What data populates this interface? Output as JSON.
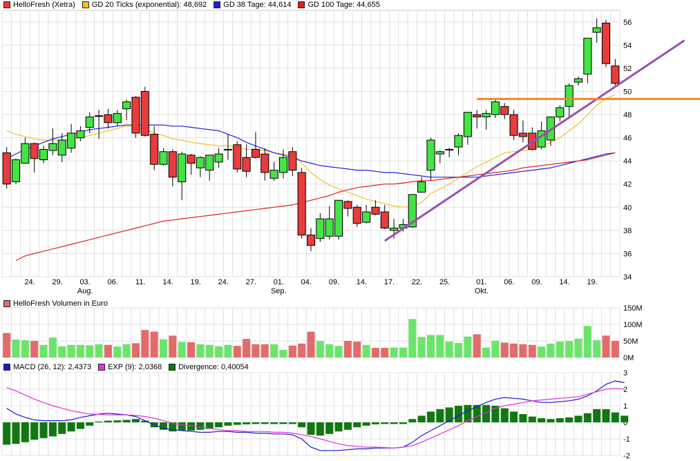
{
  "colors": {
    "up_candle": "#44e444",
    "down_candle": "#e83c3c",
    "volume_bar": "#e36b6b",
    "volume_bar_up": "#6ce46c",
    "gd20": "#f0c020",
    "gd38": "#2020dd",
    "gd100": "#dd2020",
    "trendline": "#9a4fb0",
    "resistance": "#f0882a",
    "macd": "#1a1ad0",
    "exp": "#e030e0",
    "divergence": "#117711",
    "grid": "#e0e0e0"
  },
  "legend_price": [
    {
      "label": "HelloFresh (Xetra)",
      "color": "#e03c3c"
    },
    {
      "label": "GD 20 Ticks (exponential): 48,692",
      "color": "#f0c020"
    },
    {
      "label": "GD 38 Tage: 44,614",
      "color": "#2020dd"
    },
    {
      "label": "GD 100 Tage: 44,655",
      "color": "#dd2020"
    }
  ],
  "legend_volume": [
    {
      "label": "HelloFresh Volumen in Euro",
      "color": "#e36b6b"
    }
  ],
  "legend_macd": [
    {
      "label": "MACD (26, 12): 2,4373",
      "color": "#1a1ad0"
    },
    {
      "label": "EXP (9): 2,0368",
      "color": "#e030e0"
    },
    {
      "label": "Divergence: 0,40054",
      "color": "#117711"
    }
  ],
  "chart_data": [
    {
      "type": "candlestick",
      "title": "HelloFresh (Xetra)",
      "ylim": [
        34,
        57
      ],
      "yticks": [
        34,
        36,
        38,
        40,
        42,
        44,
        46,
        48,
        50,
        52,
        54,
        56
      ],
      "xticks": [
        {
          "i": 3,
          "label": "24."
        },
        {
          "i": 6,
          "label": "29."
        },
        {
          "i": 9,
          "label": "03.",
          "month": "Aug."
        },
        {
          "i": 12,
          "label": "06."
        },
        {
          "i": 15,
          "label": "11."
        },
        {
          "i": 18,
          "label": "14."
        },
        {
          "i": 21,
          "label": "19."
        },
        {
          "i": 24,
          "label": "24."
        },
        {
          "i": 27,
          "label": "27."
        },
        {
          "i": 30,
          "label": "01.",
          "month": "Sep."
        },
        {
          "i": 33,
          "label": "04."
        },
        {
          "i": 36,
          "label": "09."
        },
        {
          "i": 39,
          "label": "14."
        },
        {
          "i": 42,
          "label": "17."
        },
        {
          "i": 45,
          "label": "22."
        },
        {
          "i": 48,
          "label": "25."
        },
        {
          "i": 52,
          "label": "01.",
          "month": "Okt."
        },
        {
          "i": 55,
          "label": "06."
        },
        {
          "i": 58,
          "label": "09."
        },
        {
          "i": 61,
          "label": "14."
        },
        {
          "i": 64,
          "label": "19."
        }
      ],
      "ohlc": [
        [
          44.7,
          45.2,
          41.6,
          42.0
        ],
        [
          42.2,
          44.2,
          42.0,
          44.1
        ],
        [
          43.8,
          46.0,
          43.8,
          45.5
        ],
        [
          45.5,
          45.6,
          43.0,
          44.2
        ],
        [
          44.1,
          45.3,
          43.8,
          45.0
        ],
        [
          44.9,
          46.8,
          44.5,
          45.5
        ],
        [
          44.5,
          46.4,
          43.9,
          45.8
        ],
        [
          45.1,
          47.2,
          44.7,
          46.4
        ],
        [
          46.0,
          47.0,
          45.7,
          46.6
        ],
        [
          46.9,
          48.2,
          46.4,
          47.8
        ],
        [
          47.9,
          48.4,
          45.9,
          47.9
        ],
        [
          48.0,
          48.5,
          46.8,
          47.3
        ],
        [
          47.3,
          48.4,
          47.0,
          48.1
        ],
        [
          48.5,
          49.3,
          47.5,
          49.1
        ],
        [
          49.5,
          49.6,
          46.0,
          46.4
        ],
        [
          50.0,
          50.4,
          46.1,
          46.2
        ],
        [
          46.3,
          47.0,
          43.2,
          43.7
        ],
        [
          43.7,
          45.1,
          43.6,
          44.8
        ],
        [
          44.8,
          45.0,
          41.8,
          42.6
        ],
        [
          42.2,
          44.8,
          40.6,
          44.6
        ],
        [
          44.5,
          44.6,
          42.8,
          43.8
        ],
        [
          43.4,
          44.4,
          42.6,
          44.3
        ],
        [
          43.2,
          44.0,
          42.3,
          44.5
        ],
        [
          43.9,
          45.1,
          43.4,
          44.6
        ],
        [
          45.0,
          46.3,
          44.1,
          45.0
        ],
        [
          45.4,
          45.7,
          43.0,
          43.3
        ],
        [
          44.3,
          45.4,
          42.6,
          43.1
        ],
        [
          45.0,
          46.5,
          44.2,
          44.3
        ],
        [
          44.6,
          45.1,
          42.3,
          43.0
        ],
        [
          42.5,
          43.9,
          42.3,
          43.2
        ],
        [
          43.0,
          45.0,
          42.5,
          44.3
        ],
        [
          44.8,
          45.2,
          42.7,
          43.2
        ],
        [
          43.0,
          43.4,
          37.3,
          37.6
        ],
        [
          37.6,
          38.2,
          36.2,
          36.7
        ],
        [
          37.3,
          39.5,
          37.0,
          39.0
        ],
        [
          37.5,
          40.1,
          37.2,
          39.0
        ],
        [
          37.5,
          40.6,
          37.2,
          40.6
        ],
        [
          40.5,
          40.6,
          39.2,
          39.9
        ],
        [
          40.0,
          40.2,
          38.3,
          38.6
        ],
        [
          38.7,
          40.2,
          38.6,
          39.6
        ],
        [
          40.0,
          40.6,
          39.3,
          39.4
        ],
        [
          39.6,
          40.2,
          38.1,
          38.2
        ],
        [
          38.0,
          39.0,
          37.3,
          38.2
        ],
        [
          38.2,
          39.0,
          37.9,
          38.5
        ],
        [
          38.3,
          41.0,
          38.2,
          41.1
        ],
        [
          41.3,
          42.6,
          41.3,
          42.2
        ],
        [
          43.2,
          46.0,
          42.3,
          45.8
        ],
        [
          44.6,
          44.9,
          43.8,
          44.8
        ],
        [
          45.0,
          45.1,
          44.3,
          45.0
        ],
        [
          45.2,
          46.4,
          44.5,
          46.2
        ],
        [
          46.1,
          48.2,
          45.4,
          48.2
        ],
        [
          48.0,
          48.4,
          46.8,
          47.8
        ],
        [
          47.8,
          48.4,
          46.7,
          48.1
        ],
        [
          48.0,
          49.3,
          47.7,
          49.1
        ],
        [
          48.7,
          49.0,
          47.6,
          48.0
        ],
        [
          48.0,
          48.4,
          45.8,
          46.2
        ],
        [
          46.4,
          47.5,
          45.6,
          46.1
        ],
        [
          46.4,
          46.9,
          44.9,
          45.0
        ],
        [
          45.2,
          47.4,
          45.0,
          46.6
        ],
        [
          45.8,
          47.6,
          45.3,
          47.8
        ],
        [
          47.8,
          48.8,
          47.4,
          48.6
        ],
        [
          48.7,
          50.7,
          47.7,
          50.5
        ],
        [
          50.8,
          51.3,
          50.5,
          51.1
        ],
        [
          51.5,
          54.6,
          50.7,
          54.6
        ],
        [
          55.1,
          56.3,
          54.2,
          55.5
        ],
        [
          55.9,
          56.2,
          52.1,
          52.4
        ],
        [
          52.2,
          52.8,
          50.5,
          50.7
        ]
      ],
      "series": [
        {
          "name": "GD 20 Ticks (exponential)",
          "start": 0,
          "values": [
            46.6,
            46.3,
            46.1,
            45.9,
            45.8,
            45.8,
            45.8,
            45.9,
            46.0,
            46.2,
            46.4,
            46.6,
            46.8,
            47.0,
            46.9,
            46.7,
            46.4,
            46.2,
            45.9,
            45.8,
            45.6,
            45.5,
            45.4,
            45.3,
            45.3,
            45.2,
            45.0,
            45.0,
            44.9,
            44.7,
            44.6,
            44.5,
            43.8,
            43.0,
            42.4,
            41.9,
            41.6,
            41.3,
            41.0,
            40.7,
            40.5,
            40.3,
            40.1,
            40.0,
            40.1,
            40.4,
            41.2,
            41.6,
            42.0,
            42.5,
            43.0,
            43.5,
            43.9,
            44.3,
            44.7,
            44.8,
            44.9,
            45.0,
            45.3,
            45.6,
            46.0,
            46.6,
            47.2,
            48.0,
            48.8,
            49.4,
            49.7
          ]
        },
        {
          "name": "GD 38 Tage",
          "start": 0,
          "values": [
            44.2,
            44.6,
            45.0,
            45.3,
            45.6,
            45.9,
            46.1,
            46.3,
            46.5,
            46.7,
            46.8,
            46.9,
            47.0,
            47.1,
            47.1,
            47.1,
            47.1,
            47.1,
            47.0,
            47.0,
            46.9,
            46.8,
            46.7,
            46.6,
            46.3,
            46.0,
            45.6,
            45.3,
            45.0,
            44.7,
            44.5,
            44.3,
            44.0,
            43.8,
            43.6,
            43.5,
            43.4,
            43.3,
            43.2,
            43.2,
            43.1,
            43.0,
            43.0,
            42.9,
            42.8,
            42.7,
            42.6,
            42.6,
            42.6,
            42.6,
            42.6,
            42.6,
            42.7,
            42.8,
            42.9,
            43.0,
            43.1,
            43.2,
            43.3,
            43.4,
            43.6,
            43.8,
            44.0,
            44.2,
            44.4,
            44.6,
            44.7
          ]
        },
        {
          "name": "GD 100 Tage",
          "start": 1,
          "values": [
            35.4,
            35.8,
            36.0,
            36.2,
            36.4,
            36.6,
            36.8,
            37.0,
            37.2,
            37.4,
            37.6,
            37.8,
            38.0,
            38.2,
            38.4,
            38.6,
            38.8,
            38.9,
            39.0,
            39.1,
            39.2,
            39.3,
            39.4,
            39.5,
            39.6,
            39.7,
            39.8,
            39.9,
            40.0,
            40.1,
            40.2,
            40.4,
            40.6,
            40.8,
            41.0,
            41.3,
            41.5,
            41.7,
            41.8,
            41.9,
            42.0,
            42.0,
            42.1,
            42.2,
            42.3,
            42.3,
            42.4,
            42.5,
            42.6,
            42.7,
            42.8,
            42.9,
            43.0,
            43.1,
            43.2,
            43.4,
            43.5,
            43.6,
            43.7,
            43.8,
            43.9,
            44.0,
            44.1,
            44.3,
            44.5,
            44.7
          ]
        }
      ],
      "annotations": [
        {
          "kind": "trendline",
          "from": {
            "i": 41.5,
            "y": 37.1
          },
          "to": {
            "i": 74,
            "y": 54.4
          }
        },
        {
          "kind": "horizontal",
          "from_i": 51.5,
          "y": 49.35
        }
      ]
    },
    {
      "type": "bar",
      "title": "HelloFresh Volumen in Euro",
      "ylim": [
        0,
        150
      ],
      "yticks": [
        {
          "v": 0,
          "label": "0M"
        },
        {
          "v": 50,
          "label": "50M"
        },
        {
          "v": 100,
          "label": "100M"
        },
        {
          "v": 150,
          "label": "150M"
        }
      ],
      "values": [
        74,
        54,
        52,
        50,
        38,
        60,
        34,
        38,
        38,
        37,
        40,
        38,
        33,
        40,
        43,
        83,
        78,
        55,
        66,
        47,
        46,
        40,
        38,
        34,
        38,
        35,
        56,
        40,
        40,
        40,
        23,
        36,
        42,
        78,
        50,
        40,
        35,
        50,
        48,
        38,
        29,
        29,
        30,
        30,
        116,
        62,
        68,
        68,
        48,
        44,
        63,
        70,
        30,
        50,
        45,
        42,
        40,
        38,
        33,
        42,
        48,
        50,
        57,
        95,
        52,
        66,
        50
      ],
      "up": [
        0,
        1,
        1,
        0,
        1,
        1,
        1,
        1,
        1,
        1,
        1,
        0,
        1,
        1,
        0,
        0,
        0,
        1,
        0,
        1,
        0,
        1,
        1,
        1,
        1,
        0,
        0,
        0,
        0,
        1,
        1,
        0,
        0,
        0,
        1,
        1,
        1,
        0,
        0,
        1,
        0,
        0,
        1,
        1,
        1,
        1,
        1,
        1,
        1,
        1,
        1,
        0,
        1,
        1,
        0,
        0,
        0,
        0,
        1,
        1,
        1,
        1,
        1,
        1,
        1,
        0,
        0
      ]
    },
    {
      "type": "line",
      "title": "MACD",
      "ylim": [
        -2,
        3
      ],
      "yticks": [
        -2,
        -1,
        0,
        1,
        2,
        3
      ],
      "series": [
        {
          "name": "MACD (26, 12)",
          "values": [
            0.85,
            0.5,
            0.3,
            0.15,
            0.1,
            0.1,
            0.1,
            0.15,
            0.3,
            0.4,
            0.5,
            0.55,
            0.5,
            0.45,
            0.35,
            0.1,
            -0.15,
            -0.35,
            -0.45,
            -0.5,
            -0.55,
            -0.6,
            -0.6,
            -0.55,
            -0.55,
            -0.6,
            -0.6,
            -0.65,
            -0.65,
            -0.7,
            -0.7,
            -0.75,
            -1.0,
            -1.5,
            -1.7,
            -1.7,
            -1.7,
            -1.65,
            -1.6,
            -1.6,
            -1.55,
            -1.55,
            -1.55,
            -1.5,
            -1.2,
            -0.8,
            -0.5,
            -0.2,
            0.1,
            0.4,
            0.7,
            0.95,
            1.2,
            1.4,
            1.5,
            1.45,
            1.4,
            1.3,
            1.2,
            1.2,
            1.25,
            1.3,
            1.4,
            1.6,
            1.9,
            2.3,
            2.5,
            2.4
          ]
        },
        {
          "name": "EXP (9)",
          "values": [
            2.1,
            1.9,
            1.65,
            1.4,
            1.2,
            1.0,
            0.85,
            0.7,
            0.6,
            0.5,
            0.48,
            0.45,
            0.45,
            0.45,
            0.42,
            0.35,
            0.25,
            0.1,
            -0.05,
            -0.15,
            -0.2,
            -0.3,
            -0.35,
            -0.45,
            -0.5,
            -0.5,
            -0.55,
            -0.55,
            -0.55,
            -0.6,
            -0.6,
            -0.65,
            -0.75,
            -0.85,
            -1.0,
            -1.15,
            -1.3,
            -1.4,
            -1.45,
            -1.5,
            -1.5,
            -1.52,
            -1.55,
            -1.5,
            -1.4,
            -1.2,
            -0.95,
            -0.7,
            -0.45,
            -0.2,
            0.1,
            0.35,
            0.6,
            0.85,
            1.0,
            1.1,
            1.2,
            1.3,
            1.35,
            1.4,
            1.45,
            1.5,
            1.55,
            1.7,
            1.85,
            2.0,
            2.05,
            2.0
          ]
        },
        {
          "name": "Divergence",
          "bar": true,
          "values": [
            -1.35,
            -1.3,
            -1.2,
            -1.05,
            -0.95,
            -0.85,
            -0.7,
            -0.55,
            -0.4,
            -0.2,
            0.05,
            0.1,
            0.12,
            0.15,
            0.2,
            0.1,
            -0.3,
            -0.45,
            -0.55,
            -0.5,
            -0.5,
            -0.45,
            -0.4,
            -0.3,
            -0.2,
            -0.15,
            -0.12,
            -0.1,
            -0.1,
            -0.1,
            -0.1,
            -0.1,
            -0.3,
            -0.75,
            -0.8,
            -0.7,
            -0.55,
            -0.45,
            -0.3,
            -0.2,
            -0.12,
            -0.1,
            -0.1,
            -0.1,
            0.2,
            0.4,
            0.65,
            0.8,
            0.9,
            1.0,
            1.05,
            1.05,
            1.05,
            1.0,
            0.85,
            0.65,
            0.5,
            0.35,
            0.25,
            0.2,
            0.25,
            0.3,
            0.4,
            0.55,
            0.8,
            0.8,
            0.6,
            0.4
          ]
        }
      ]
    }
  ]
}
